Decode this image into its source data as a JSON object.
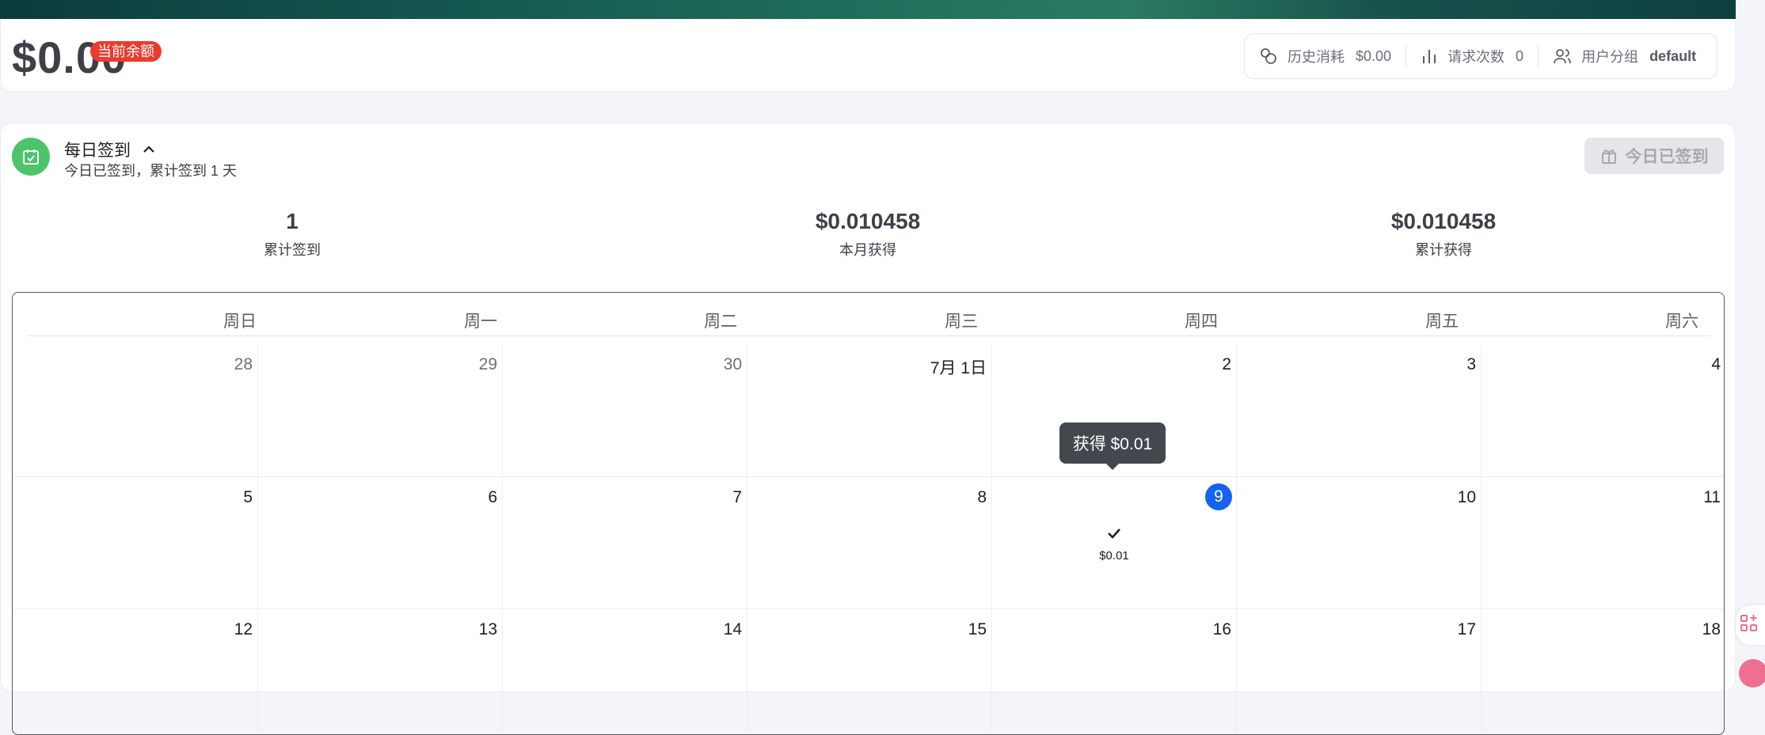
{
  "balance": {
    "amount": "$0.00",
    "badge": "当前余额"
  },
  "stats": [
    {
      "icon": "coins-icon",
      "label": "历史消耗",
      "value": "$0.00"
    },
    {
      "icon": "bar-chart-icon",
      "label": "请求次数",
      "value": "0"
    },
    {
      "icon": "users-icon",
      "label": "用户分组",
      "value": "default"
    }
  ],
  "checkin": {
    "title": "每日签到",
    "subtitle": "今日已签到，累计签到 1 天",
    "button_label": "今日已签到",
    "summary": [
      {
        "value": "1",
        "label": "累计签到"
      },
      {
        "value": "$0.010458",
        "label": "本月获得"
      },
      {
        "value": "$0.010458",
        "label": "累计获得"
      }
    ]
  },
  "calendar": {
    "weekdays": [
      "周日",
      "周一",
      "周二",
      "周三",
      "周四",
      "周五",
      "周六"
    ],
    "weeks": [
      [
        "28",
        "29",
        "30",
        "7月 1日",
        "2",
        "3",
        "4"
      ],
      [
        "5",
        "6",
        "7",
        "8",
        "9",
        "10",
        "11"
      ],
      [
        "12",
        "13",
        "14",
        "15",
        "16",
        "17",
        "18"
      ]
    ],
    "today": "9",
    "checked_day_amount": "$0.01",
    "tooltip": "获得 $0.01"
  },
  "colors": {
    "accent_blue": "#1463f3",
    "badge_red": "#ea3b2e",
    "checkin_green": "#4cc46b"
  }
}
